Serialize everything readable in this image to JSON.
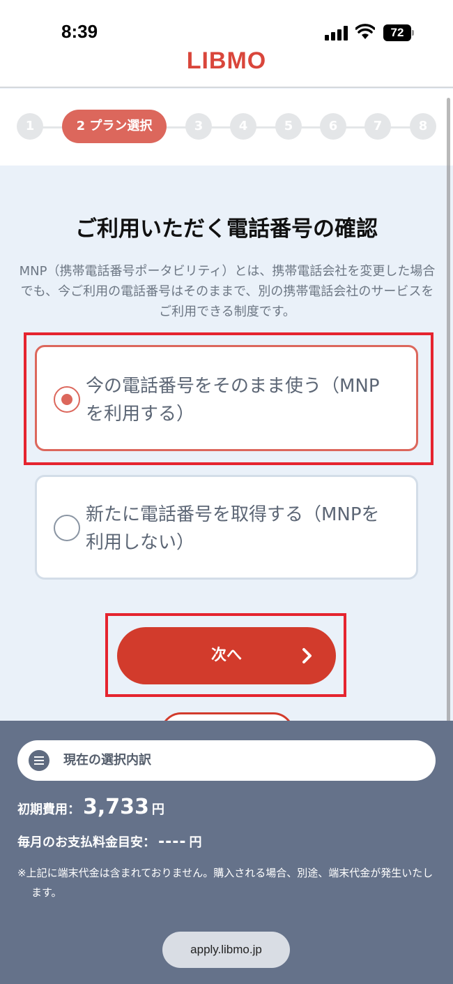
{
  "status_bar": {
    "time": "8:39",
    "battery": "72"
  },
  "header": {
    "logo": "LIBMO"
  },
  "stepper": {
    "steps": [
      "1",
      "2 プラン選択",
      "3",
      "4",
      "5",
      "6",
      "7",
      "8"
    ],
    "active_step": "2"
  },
  "main": {
    "title": "ご利用いただく電話番号の確認",
    "description": "MNP（携帯電話番号ポータビリティ）とは、携帯電話会社を変更した場合でも、今ご利用の電話番号はそのままで、別の携帯電話会社のサービスをご利用できる制度です。",
    "options": [
      {
        "label": "今の電話番号をそのまま使う（MNPを利用する）",
        "selected": true
      },
      {
        "label": "新たに電話番号を取得する（MNPを利用しない）",
        "selected": false
      }
    ],
    "next_button": "次へ",
    "next_icon": "chevron-right-icon"
  },
  "summary": {
    "bar_label": "現在の選択内訳",
    "initial_fee_label": "初期費用：",
    "initial_fee_value": "3,733",
    "initial_fee_unit": "円",
    "monthly_label": "毎月のお支払料金目安：",
    "monthly_value": "----",
    "monthly_unit": "円",
    "note": "※上記に端末代金は含まれておりません。購入される場合、別途、端末代金が発生いたします。"
  },
  "browser": {
    "url": "apply.libmo.jp"
  },
  "colors": {
    "brand": "#d23b2c",
    "accent": "#dc675c",
    "summary_bg": "#65728a",
    "highlight": "#e5242f"
  }
}
